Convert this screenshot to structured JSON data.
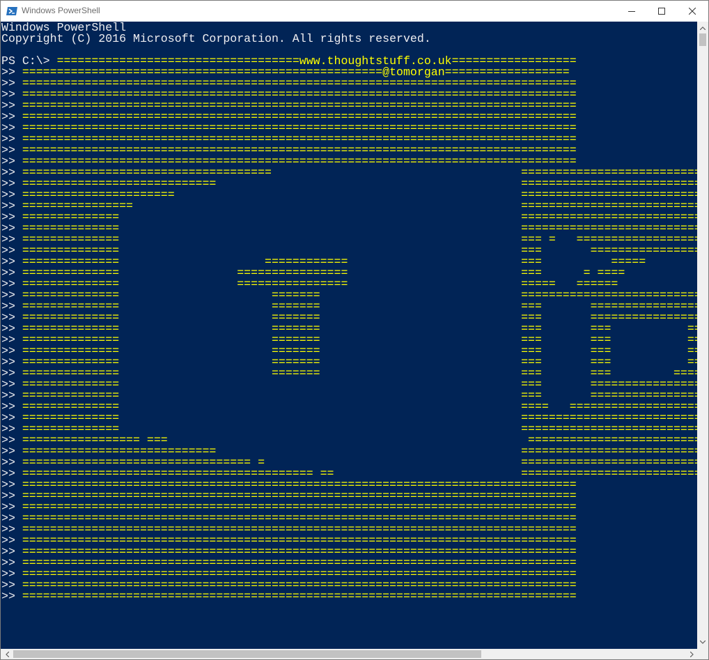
{
  "window": {
    "title": "Windows PowerShell",
    "icon": "powershell-icon",
    "controls": [
      "minimize-icon",
      "maximize-icon",
      "close-icon"
    ]
  },
  "colors": {
    "console_bg": "#012456",
    "text": "#eeedf0",
    "highlight": "#ffff00"
  },
  "console": {
    "header": [
      "Windows PowerShell",
      "Copyright (C) 2016 Microsoft Corporation. All rights reserved."
    ],
    "prompt": "PS C:\\> ",
    "continuation": ">> ",
    "first_command": "===================================www.thoughtstuff.co.uk==================",
    "art_lines": [
      "====================================================@tomorgan==================",
      "================================================================================",
      "================================================================================",
      "================================================================================",
      "================================================================================",
      "================================================================================",
      "================================================================================",
      "================================================================================",
      "================================================================================",
      "====================================                                    ====================================",
      "============================                                            ====================================",
      "======================                                                  ====================================",
      "================                                                        ====================================",
      "==============                                                          ====================================",
      "==============                                                          ====================================",
      "==============                                                          === =   ===========================",
      "==============                                                          ===       ===========================",
      "==============                     ============                         ===          =====           ===============",
      "==============                 ================                         ===      = ====              ===============",
      "==============                 ================                         =====   ======              ===============",
      "==============                      =======                             ========================================",
      "==============                      =======                             ===       ===========================",
      "==============                      =======                             ===       ===========================",
      "==============                      =======                             ===       ===           ===============",
      "==============                      =======                             ===       ===           ===============",
      "==============                      =======                             ===       ===           ===============",
      "==============                      =======                             ===       ===           ===============",
      "==============                      =======                             ===       ===         =================",
      "==============                                                          ===       ===========================",
      "==============                                                          ===       ===========================",
      "==============                                                          ====   ==============================",
      "==============                                                          ====================================",
      "==============                                                          ====================================",
      "================= ===                                                    ====================================",
      "============================                                            ====================================",
      "================================= =                                     ====================================",
      "========================================== ==                           ====================================",
      "================================================================================",
      "================================================================================",
      "================================================================================",
      "================================================================================",
      "================================================================================",
      "================================================================================",
      "================================================================================",
      "================================================================================",
      "================================================================================",
      "================================================================================",
      "================================================================================"
    ]
  }
}
